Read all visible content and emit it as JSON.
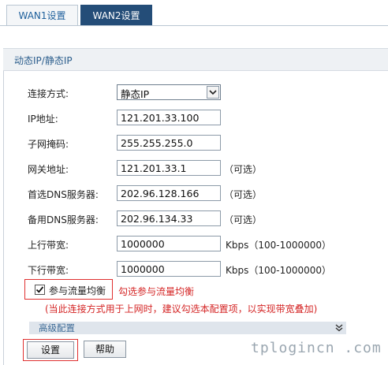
{
  "tabs": [
    {
      "label": "WAN1设置",
      "active": true
    },
    {
      "label": "WAN2设置",
      "active": false
    }
  ],
  "section": {
    "title": "动态IP/静态IP"
  },
  "form": {
    "connection_type": {
      "label": "连接方式:",
      "value": "静态IP"
    },
    "ip_address": {
      "label": "IP地址:",
      "value": "121.201.33.100"
    },
    "subnet_mask": {
      "label": "子网掩码:",
      "value": "255.255.255.0"
    },
    "gateway": {
      "label": "网关地址:",
      "value": "121.201.33.1",
      "hint": "（可选）"
    },
    "primary_dns": {
      "label": "首选DNS服务器:",
      "value": "202.96.128.166",
      "hint": "（可选）"
    },
    "secondary_dns": {
      "label": "备用DNS服务器:",
      "value": "202.96.134.33",
      "hint": "（可选）"
    },
    "upstream": {
      "label": "上行带宽:",
      "value": "1000000",
      "hint": "Kbps（100-1000000）"
    },
    "downstream": {
      "label": "下行带宽:",
      "value": "1000000",
      "hint": "Kbps（100-1000000）"
    }
  },
  "load_balance": {
    "label": "参与流量均衡",
    "checked": true,
    "annotation": "勾选参与流量均衡",
    "note": "(当此连接方式用于上网时，建议勾选本配置项，以实现带宽叠加)"
  },
  "advanced": {
    "label": "高级配置"
  },
  "buttons": {
    "save": "设置",
    "help": "帮助"
  },
  "watermark": "tplogincn .com",
  "colors": {
    "accent_red": "#d42424",
    "tab_active_bg": "#244d78"
  }
}
